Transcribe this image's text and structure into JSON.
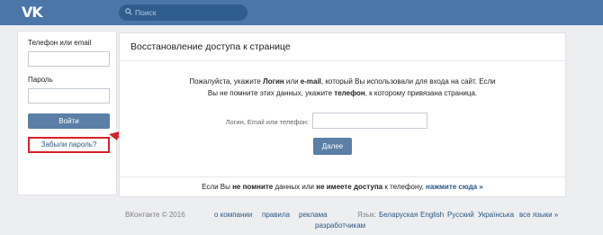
{
  "header": {
    "logo_text": "VK",
    "search": {
      "placeholder": "Поиск",
      "icon": "search-icon"
    }
  },
  "login_panel": {
    "phone_label": "Телефон или email",
    "password_label": "Пароль",
    "login_button": "Войти",
    "forgot_link": "Забыли пароль?"
  },
  "recovery": {
    "title": "Восстановление доступа к странице",
    "desc": {
      "p1": "Пожалуйста, укажите ",
      "b1": "Логин",
      "p2": " или ",
      "b2": "e-mail",
      "p3": ", который Вы использовали для входа на сайт. Если",
      "p4": "Вы не помните этих данных, укажите ",
      "b3": "телефон",
      "p5": ", к которому привязана страница."
    },
    "field_label": "Логин, Email или телефон:",
    "next_button": "Далее",
    "footer": {
      "p1": "Если Вы ",
      "b1": "не помните",
      "p2": " данных или ",
      "b2": "не имеете доступа",
      "p3": " к телефону, ",
      "link": "нажмите сюда »"
    }
  },
  "page_footer": {
    "copyright": "ВКонтакте © 2016",
    "links": [
      "о компании",
      "правила",
      "реклама",
      "разработчикам"
    ],
    "language_label": "Язык:",
    "languages": [
      "Беларуская",
      "English",
      "Русский",
      "Українська",
      "все языки »"
    ]
  },
  "colors": {
    "header_bg": "#4a76a8",
    "button_bg": "#5b7fa6",
    "link": "#2a5885",
    "highlight": "#d6212b"
  }
}
